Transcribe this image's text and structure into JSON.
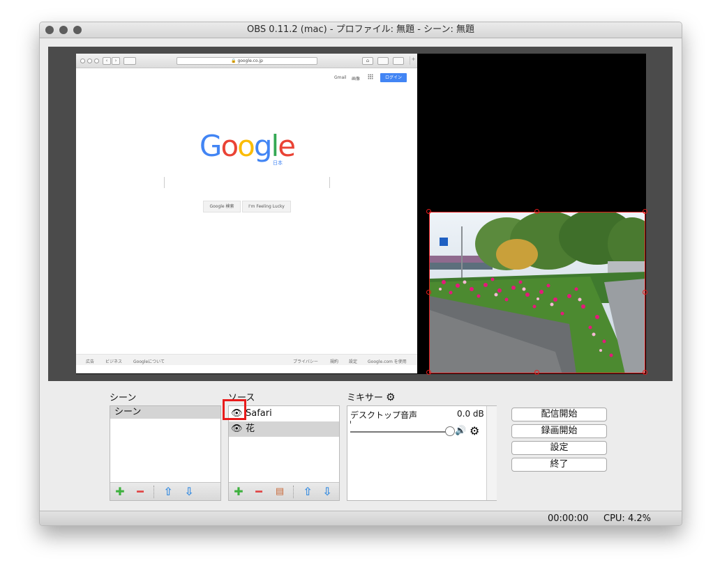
{
  "window": {
    "title": "OBS 0.11.2 (mac) - プロファイル: 無題 - シーン: 無題"
  },
  "preview": {
    "safari": {
      "url": "google.co.jp",
      "gmail": "Gmail",
      "images": "画像",
      "login": "ログイン",
      "logo_letters": [
        {
          "ch": "G",
          "color": "#4285f4"
        },
        {
          "ch": "o",
          "color": "#ea4335"
        },
        {
          "ch": "o",
          "color": "#fbbc05"
        },
        {
          "ch": "g",
          "color": "#4285f4"
        },
        {
          "ch": "l",
          "color": "#34a853"
        },
        {
          "ch": "e",
          "color": "#ea4335"
        }
      ],
      "logo_sub": "日本",
      "search_button": "Google 検索",
      "lucky_button": "I'm Feeling Lucky",
      "footer_left": [
        "広告",
        "ビジネス",
        "Googleについて"
      ],
      "footer_right": [
        "プライバシー",
        "規約",
        "設定",
        "Google.com を使用"
      ]
    }
  },
  "panels": {
    "scenes": {
      "label": "シーン",
      "items": [
        "シーン"
      ]
    },
    "sources": {
      "label": "ソース",
      "items": [
        "Safari",
        "花"
      ]
    },
    "mixer": {
      "label": "ミキサー",
      "channel": "デスクトップ音声",
      "level": "0.0 dB",
      "volume": 1.0
    }
  },
  "buttons": {
    "stream": "配信開始",
    "record": "録画開始",
    "settings": "設定",
    "exit": "終了"
  },
  "status": {
    "time": "00:00:00",
    "cpu": "CPU: 4.2%"
  },
  "colors": {
    "accent_red": "#e81b1b",
    "add_green": "#3fb13f",
    "remove_red": "#e04545",
    "arrow_blue": "#3d8fe0"
  }
}
